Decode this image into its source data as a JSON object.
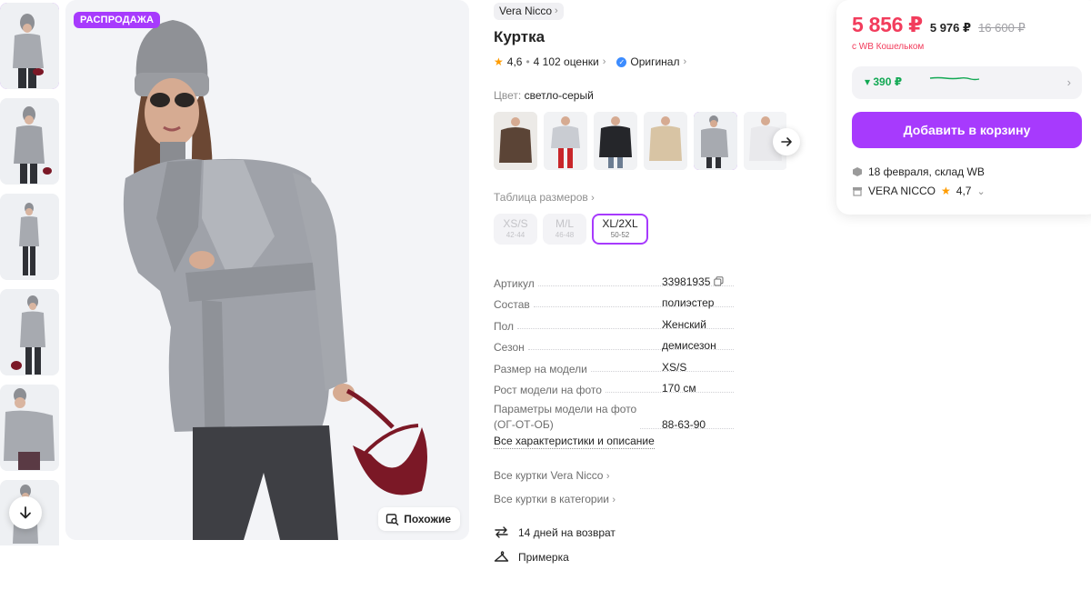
{
  "gallery": {
    "sale_badge": "РАСПРОДАЖА",
    "similar_label": "Похожие",
    "thumbnail_count": 6
  },
  "product": {
    "brand": "Vera Nicco",
    "title": "Куртка",
    "rating": "4,6",
    "reviews": "4 102 оценки",
    "original_label": "Оригинал"
  },
  "color": {
    "label": "Цвет:",
    "value": "светло-серый"
  },
  "sizes": {
    "table_link": "Таблица размеров",
    "items": [
      {
        "size": "XS/S",
        "ru": "42-44"
      },
      {
        "size": "M/L",
        "ru": "46-48"
      },
      {
        "size": "XL/2XL",
        "ru": "50-52"
      }
    ]
  },
  "specs": [
    {
      "key": "Артикул",
      "value": "33981935"
    },
    {
      "key": "Состав",
      "value": "полиэстер"
    },
    {
      "key": "Пол",
      "value": "Женский"
    },
    {
      "key": "Сезон",
      "value": "демисезон"
    },
    {
      "key": "Размер на модели",
      "value": "XS/S"
    },
    {
      "key": "Рост модели на фото",
      "value": "170 см"
    },
    {
      "key": "Параметры модели на фото",
      "key2": "(ОГ-ОТ-ОБ)",
      "value": "88-63-90"
    }
  ],
  "links": {
    "all_characteristics": "Все характеристики и описание",
    "all_brand": "Все куртки Vera Nicco",
    "all_category": "Все куртки в категории"
  },
  "perks": {
    "returns": "14 дней на возврат",
    "fitting": "Примерка"
  },
  "buy": {
    "price": "5 856 ₽",
    "price_no_wallet": "5 976 ₽",
    "price_old": "16 600 ₽",
    "wallet_note": "с WB Кошельком",
    "price_drop": "▾ 390 ₽",
    "add_to_cart": "Добавить в корзину",
    "delivery": "18 февраля, склад WB",
    "seller": "VERA NICCO",
    "seller_rating": "4,7"
  },
  "colors": {
    "accent": "#a73afd",
    "price_red": "#f23c5c",
    "green": "#12a853"
  }
}
